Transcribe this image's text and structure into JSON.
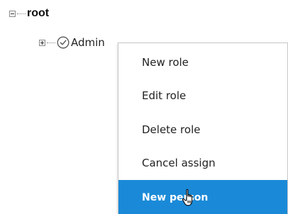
{
  "tree": {
    "root": {
      "label": "root",
      "expanded": true
    },
    "child": {
      "label": "Admin",
      "expanded": false,
      "icon": "check-circle-icon"
    }
  },
  "context_menu": {
    "items": [
      {
        "label": "New role",
        "highlighted": false
      },
      {
        "label": "Edit role",
        "highlighted": false
      },
      {
        "label": "Delete role",
        "highlighted": false
      },
      {
        "label": "Cancel assign",
        "highlighted": false
      },
      {
        "label": "New person",
        "highlighted": true
      }
    ]
  },
  "colors": {
    "highlight": "#1a8ad8",
    "highlight_text": "#ffffff",
    "menu_border": "#c8c8c8"
  },
  "cursor": "hand-pointer-icon"
}
